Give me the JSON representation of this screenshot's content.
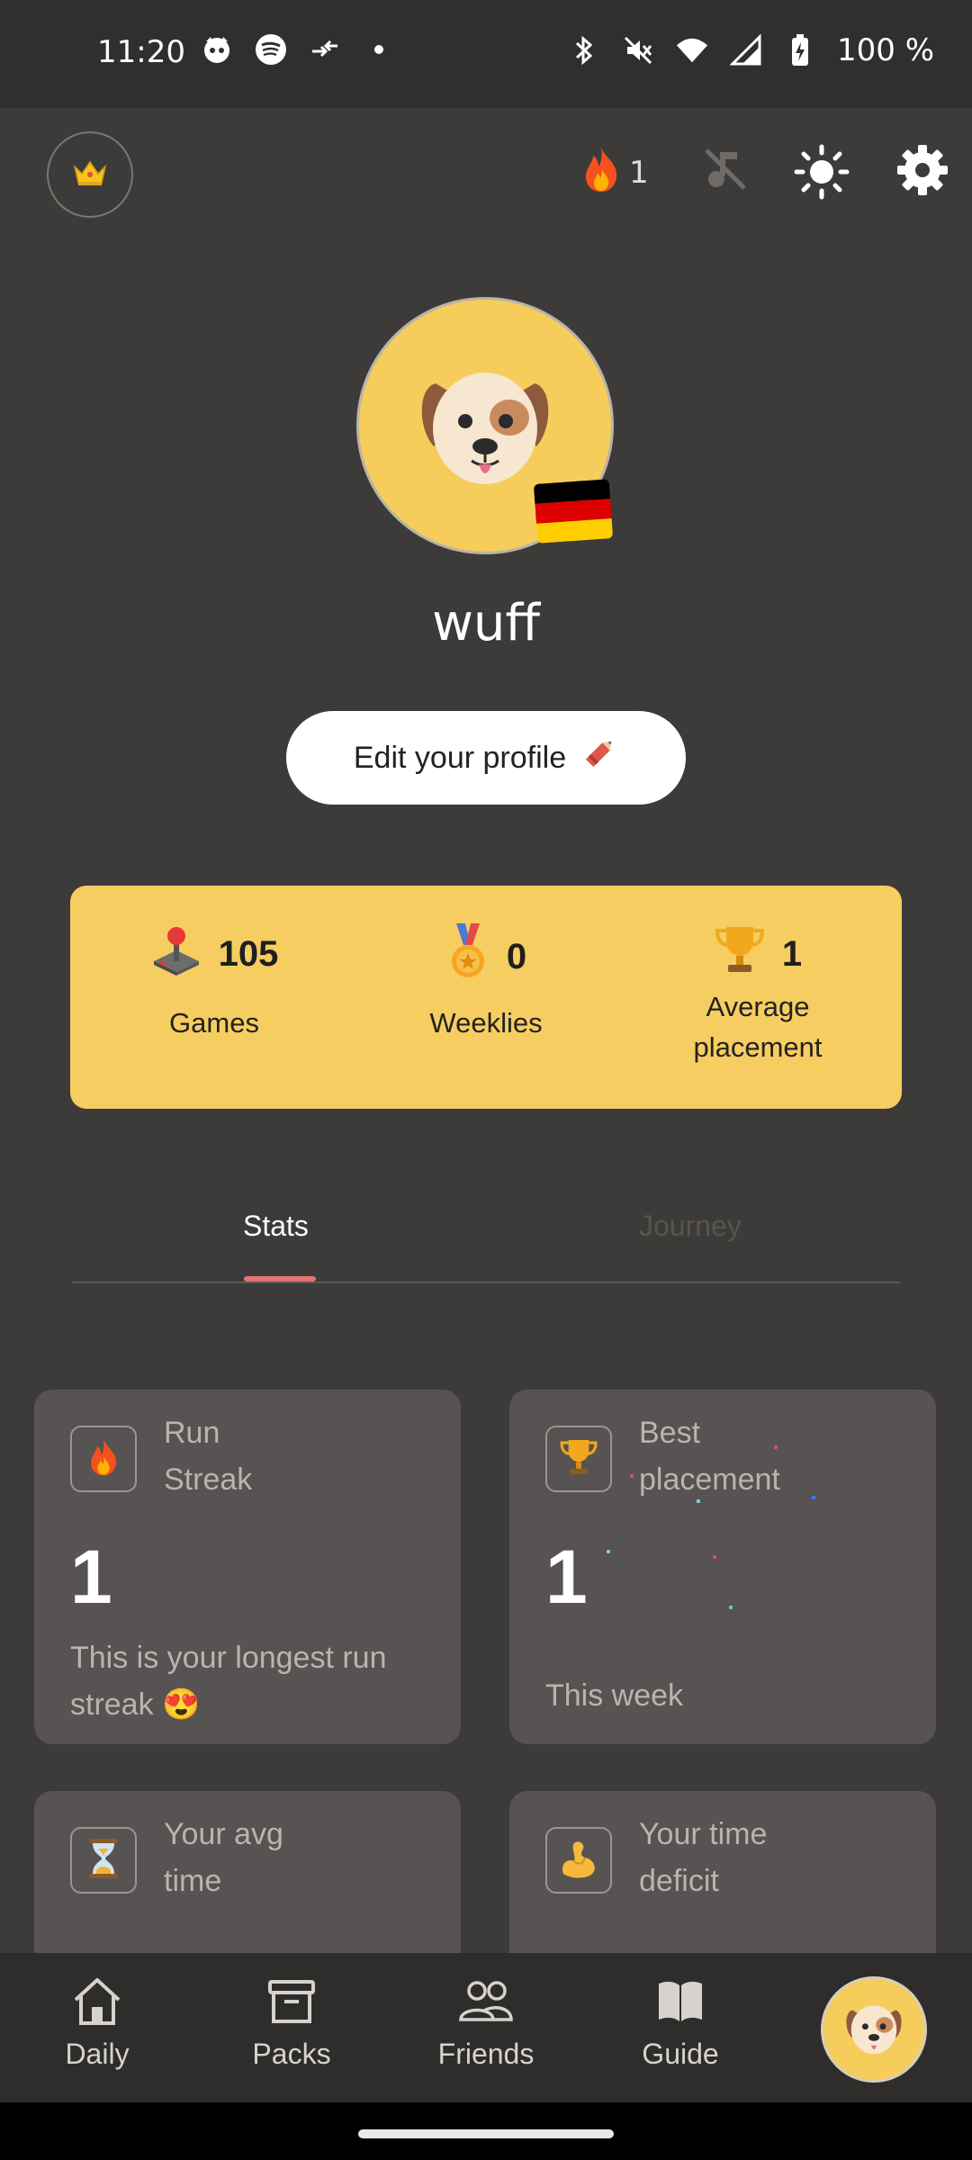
{
  "status_bar": {
    "time": "11:20",
    "battery": "100 %"
  },
  "top_bar": {
    "streak_count": "1"
  },
  "profile": {
    "username": "wuff",
    "edit_button_label": "Edit your profile",
    "flag": [
      "#000000",
      "#dd0000",
      "#ffce00"
    ]
  },
  "summary": [
    {
      "value": "105",
      "label": "Games",
      "icon": "joystick-icon"
    },
    {
      "value": "0",
      "label": "Weeklies",
      "icon": "medal-icon"
    },
    {
      "value": "1",
      "label": "Average\nplacement",
      "icon": "trophy-icon"
    }
  ],
  "tabs": [
    {
      "label": "Stats",
      "active": true
    },
    {
      "label": "Journey",
      "active": false
    }
  ],
  "tiles": [
    {
      "title": "Run\nStreak",
      "value": "1",
      "desc": "This is your longest run streak 😍",
      "icon": "fire-icon"
    },
    {
      "title": "Best\nplacement",
      "value": "1",
      "desc": "This week",
      "icon": "trophy-icon"
    },
    {
      "title": "Your avg\ntime",
      "value": "",
      "desc": "",
      "icon": "hourglass-icon"
    },
    {
      "title": "Your time\ndeficit",
      "value": "",
      "desc": "",
      "icon": "flexed-biceps-icon"
    }
  ],
  "bottom_nav": [
    {
      "label": "Daily",
      "icon": "home-icon"
    },
    {
      "label": "Packs",
      "icon": "archive-box-icon"
    },
    {
      "label": "Friends",
      "icon": "people-icon"
    },
    {
      "label": "Guide",
      "icon": "book-icon"
    }
  ],
  "colors": {
    "background": "#3d3b3a",
    "summary_card": "#f6cd60",
    "tab_indicator": "#e57373",
    "tile": "#565352"
  }
}
